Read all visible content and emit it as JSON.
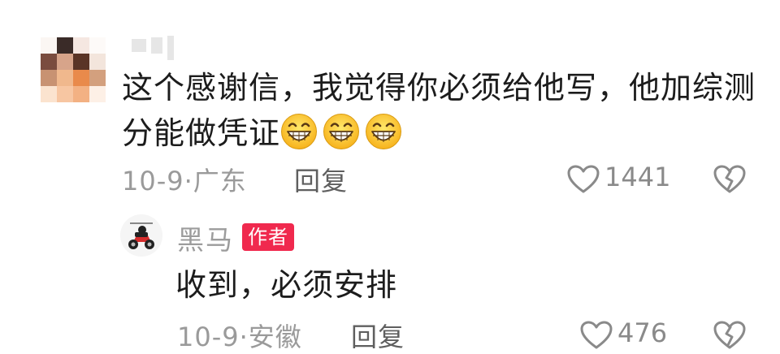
{
  "comment": {
    "avatar_style": "pixelated",
    "text": "这个感谢信，我觉得你必须给他写，他加综测分能做凭证",
    "emoji": [
      "grinning-face",
      "grinning-face",
      "grinning-face"
    ],
    "date": "10-9",
    "separator": "·",
    "location": "广东",
    "reply_label": "回复",
    "like_count": "1441"
  },
  "reply": {
    "author_name": "黑马",
    "author_badge": "作者",
    "text": "收到，必须安排",
    "date": "10-9",
    "separator": "·",
    "location": "安徽",
    "reply_label": "回复",
    "like_count": "476"
  },
  "colors": {
    "badge_bg": "#f0294e",
    "meta_text": "#9a9a9a",
    "body_text": "#1c1c1c"
  },
  "icons": [
    "heart-outline-icon",
    "broken-heart-outline-icon"
  ]
}
